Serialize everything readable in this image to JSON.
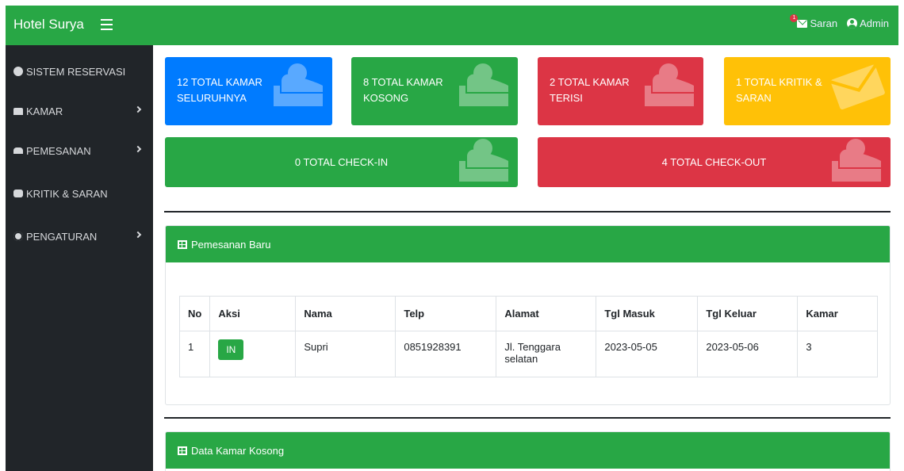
{
  "navbar": {
    "brand": "Hotel Surya",
    "saran_label": "Saran",
    "saran_badge": "1",
    "admin_label": "Admin"
  },
  "sidebar": {
    "items": [
      {
        "label": "SISTEM RESERVASI",
        "icon": "tachometer-icon",
        "has_arrow": false
      },
      {
        "label": "KAMAR",
        "icon": "bed-icon",
        "has_arrow": true
      },
      {
        "label": "PEMESANAN",
        "icon": "users-icon",
        "has_arrow": true
      },
      {
        "label": "KRITIK & SARAN",
        "icon": "comment-icon",
        "has_arrow": false
      },
      {
        "label": "PENGATURAN",
        "icon": "gear-icon",
        "has_arrow": true
      }
    ]
  },
  "stats": {
    "total_rooms": "12 TOTAL KAMAR SELURUHNYA",
    "empty_rooms": "8 TOTAL KAMAR KOSONG",
    "filled_rooms": "2 TOTAL KAMAR TERISI",
    "feedback": "1 TOTAL KRITIK & SARAN",
    "checkin": "0 TOTAL CHECK-IN",
    "checkout": "4 TOTAL CHECK-OUT"
  },
  "colors": {
    "primary": "#007bff",
    "success": "#28a745",
    "danger": "#dc3545",
    "warning": "#ffc107",
    "sidebar": "#212529"
  },
  "panel_new_orders": {
    "title": "Pemesanan Baru",
    "columns": [
      "No",
      "Aksi",
      "Nama",
      "Telp",
      "Alamat",
      "Tgl Masuk",
      "Tgl Keluar",
      "Kamar"
    ],
    "rows": [
      {
        "no": "1",
        "action": "IN",
        "nama": "Supri",
        "telp": "0851928391",
        "alamat": "Jl. Tenggara selatan",
        "tgl_masuk": "2023-05-05",
        "tgl_keluar": "2023-05-06",
        "kamar": "3"
      }
    ]
  },
  "panel_empty_rooms": {
    "title": "Data Kamar Kosong"
  }
}
